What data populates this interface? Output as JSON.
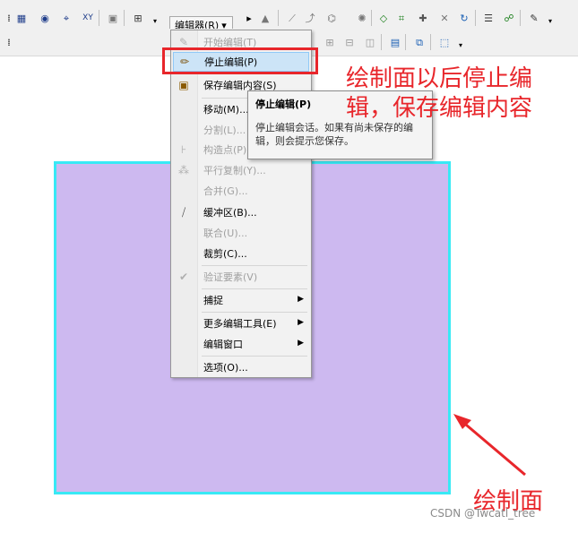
{
  "toolbar": {
    "editor_menu_label": "编辑器(R)",
    "editor_menu_caret": "▾"
  },
  "menu": {
    "items": [
      {
        "label": "开始编辑(T)",
        "icon": "start-edit-icon"
      },
      {
        "label": "停止编辑(P)",
        "icon": "stop-edit-icon"
      },
      {
        "label": "保存编辑内容(S)",
        "icon": "save-edits-icon"
      },
      {
        "label": "移动(M)...",
        "icon": ""
      },
      {
        "label": "分割(L)...",
        "icon": ""
      },
      {
        "label": "构造点(P)...",
        "icon": "construct-points-icon"
      },
      {
        "label": "平行复制(Y)...",
        "icon": "copy-parallel-icon"
      },
      {
        "label": "合并(G)...",
        "icon": ""
      },
      {
        "label": "缓冲区(B)...",
        "icon": "buffer-icon"
      },
      {
        "label": "联合(U)...",
        "icon": ""
      },
      {
        "label": "裁剪(C)...",
        "icon": ""
      },
      {
        "label": "验证要素(V)",
        "icon": "validate-features-icon"
      },
      {
        "label": "捕捉",
        "icon": ""
      },
      {
        "label": "更多编辑工具(E)",
        "icon": ""
      },
      {
        "label": "编辑窗口",
        "icon": ""
      },
      {
        "label": "选项(O)...",
        "icon": ""
      }
    ]
  },
  "tooltip": {
    "title": "停止编辑(P)",
    "body": "停止编辑会话。如果有尚未保存的编辑，则会提示您保存。"
  },
  "annotations": {
    "top_line1": "绘制面以后停止编",
    "top_line2": "辑，保存编辑内容",
    "bottom": "绘制面"
  },
  "watermark": "CSDN @Twcatl_tree",
  "colors": {
    "polygon_fill": "#cdb9f0",
    "polygon_border": "#38e9f5",
    "annotation_red": "#e8262b",
    "highlight": "#cce4f7"
  }
}
